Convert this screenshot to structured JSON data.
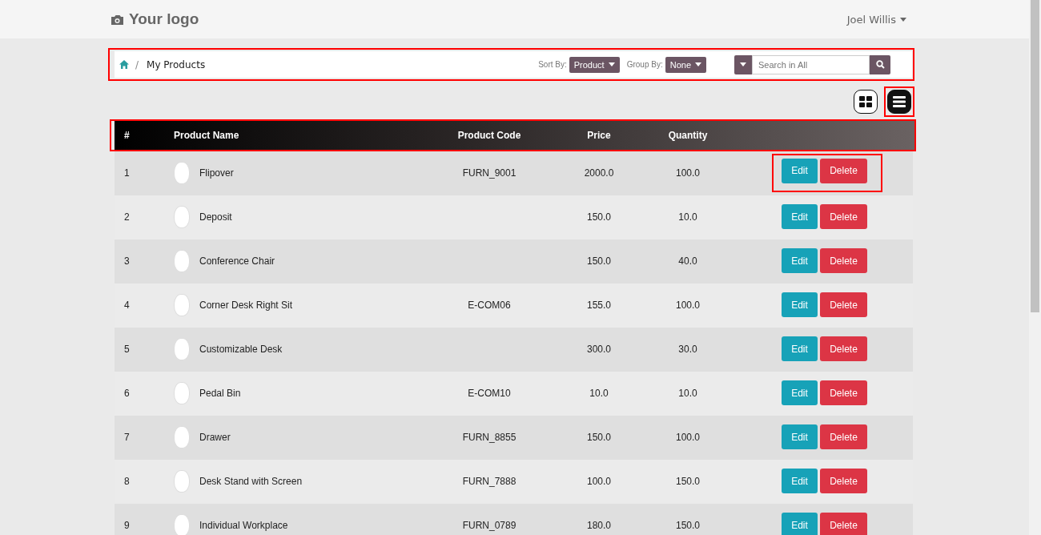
{
  "navbar": {
    "logo": "Your logo",
    "user": "Joel Willis"
  },
  "breadcrumb_separator": "/",
  "breadcrumb": [
    "My Products"
  ],
  "sort": {
    "label": "Sort By:",
    "value": "Product"
  },
  "group": {
    "label": "Group By:",
    "value": "None"
  },
  "search": {
    "placeholder": "Search in All"
  },
  "view_toggle": [
    {
      "kind": "grid",
      "selected": false
    },
    {
      "kind": "list",
      "selected": true
    }
  ],
  "table": {
    "columns": [
      "#",
      "Product Name",
      "Product Code",
      "Price",
      "Quantity"
    ],
    "rows": [
      {
        "num": "1",
        "name": "Flipover",
        "code": "FURN_9001",
        "price": "2000.0",
        "quantity": "100.0",
        "actions": [
          "Edit",
          "Delete"
        ]
      },
      {
        "num": "2",
        "name": "Deposit",
        "price": "150.0",
        "quantity": "10.0",
        "actions": [
          "Edit",
          "Delete"
        ]
      },
      {
        "num": "3",
        "name": "Conference Chair",
        "price": "150.0",
        "quantity": "40.0",
        "actions": [
          "Edit",
          "Delete"
        ]
      },
      {
        "num": "4",
        "name": "Corner Desk Right Sit",
        "code": "E-COM06",
        "price": "155.0",
        "quantity": "100.0",
        "actions": [
          "Edit",
          "Delete"
        ]
      },
      {
        "num": "5",
        "name": "Customizable Desk",
        "price": "300.0",
        "quantity": "30.0",
        "actions": [
          "Edit",
          "Delete"
        ]
      },
      {
        "num": "6",
        "name": "Pedal Bin",
        "code": "E-COM10",
        "price": "10.0",
        "quantity": "10.0",
        "actions": [
          "Edit",
          "Delete"
        ]
      },
      {
        "num": "7",
        "name": "Drawer",
        "code": "FURN_8855",
        "price": "150.0",
        "quantity": "100.0",
        "actions": [
          "Edit",
          "Delete"
        ]
      },
      {
        "num": "8",
        "name": "Desk Stand with Screen",
        "code": "FURN_7888",
        "price": "100.0",
        "quantity": "150.0",
        "actions": [
          "Edit",
          "Delete"
        ]
      },
      {
        "num": "9",
        "name": "Individual Workplace",
        "code": "FURN_0789",
        "price": "180.0",
        "quantity": "150.0",
        "actions": [
          "Edit",
          "Delete"
        ]
      }
    ]
  }
}
